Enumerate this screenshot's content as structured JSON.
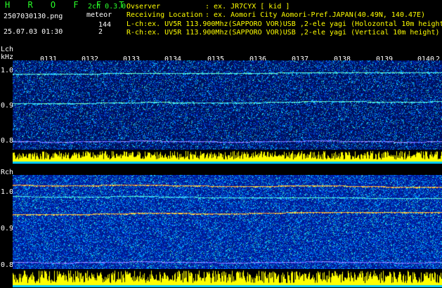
{
  "header": {
    "app_name": "H R O F F T",
    "mode": "2ch 0.3.0",
    "filename": "2507030130.png",
    "type_label": "meteor",
    "count_a": "144",
    "count_b": "2",
    "datetime": "25.07.03 01:30",
    "observer_label": "Ovserver",
    "observer_value": ": ex. JR7CYX [ kid ]",
    "location_label": "Receiving Location",
    "location_value": ": ex. Aomori City Aomori-Pref.JAPAN(40.49N, 140.47E)",
    "lch_info": "L-ch:ex. UV5R 113.900Mhz(SAPPORO VOR)USB ,2-ele yagi (Holozontal 10m height",
    "rch_info": "R-ch:ex. UV5R 113.900Mhz(SAPPORO VOR)USB ,2-ele yagi (Vertical 10m height)"
  },
  "lch": {
    "label": "Lch",
    "unit": "kHz",
    "y_ticks": [
      "1.0",
      "0.9",
      "0.8"
    ]
  },
  "rch": {
    "label": "Rch",
    "y_ticks": [
      "1.0",
      "0.9",
      "0.8"
    ]
  },
  "time_ticks": [
    "0131",
    "0132",
    "0133",
    "0134",
    "0135",
    "0136",
    "0137",
    "0138",
    "0139",
    "0140",
    "2"
  ],
  "colors": {
    "text_green": "#29ff29",
    "amplitude": "#ffff00",
    "background": "#000000"
  }
}
